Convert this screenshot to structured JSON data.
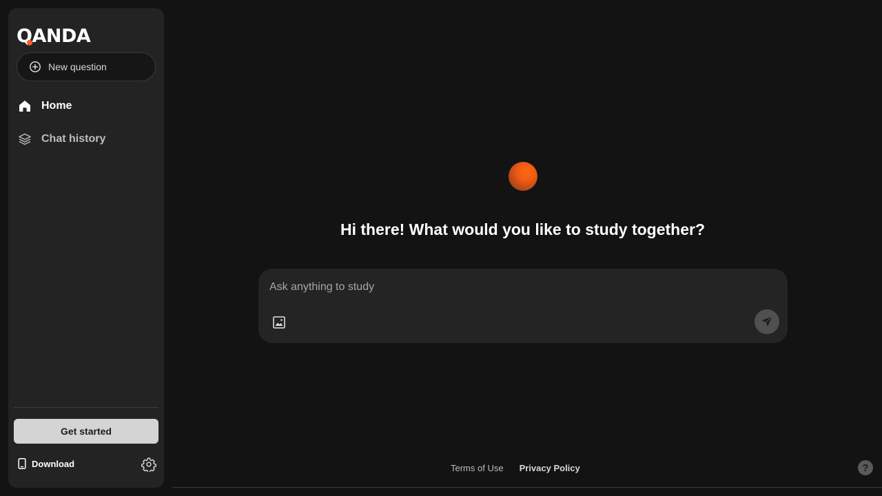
{
  "brand": {
    "logo_text": "QANDA",
    "accent_color": "#ff5a1f"
  },
  "sidebar": {
    "new_question_label": "New question",
    "new_question_icon": "plus-circle-icon",
    "items": [
      {
        "label": "Home",
        "icon": "home-icon",
        "active": true
      },
      {
        "label": "Chat history",
        "icon": "layers-icon",
        "active": false
      }
    ],
    "get_started_label": "Get started",
    "download_label": "Download",
    "download_icon": "phone-icon",
    "settings_icon": "gear-icon"
  },
  "main": {
    "greeting": "Hi there! What would you like to study together?",
    "composer": {
      "placeholder": "Ask anything to study",
      "image_icon": "image-icon",
      "send_icon": "send-icon"
    }
  },
  "footer": {
    "terms_label": "Terms of Use",
    "privacy_label": "Privacy Policy",
    "help_label": "?"
  }
}
